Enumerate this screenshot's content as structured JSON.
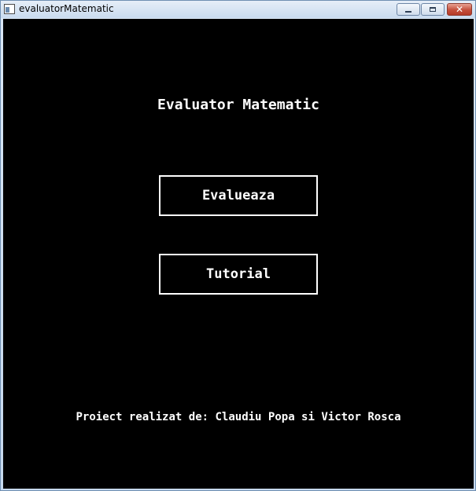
{
  "window": {
    "title": "evaluatorMatematic",
    "icon": "app-window-icon",
    "controls": {
      "minimize_icon": "minimize-icon",
      "maximize_icon": "maximize-icon",
      "close_icon": "close-icon",
      "close_glyph": "✕"
    }
  },
  "main": {
    "heading": "Evaluator Matematic",
    "evaluate_button": "Evalueaza",
    "tutorial_button": "Tutorial",
    "credits": "Proiect realizat de: Claudiu Popa si Victor Rosca"
  },
  "colors": {
    "background": "#000000",
    "foreground": "#ffffff",
    "close_button": "#c5503c"
  }
}
